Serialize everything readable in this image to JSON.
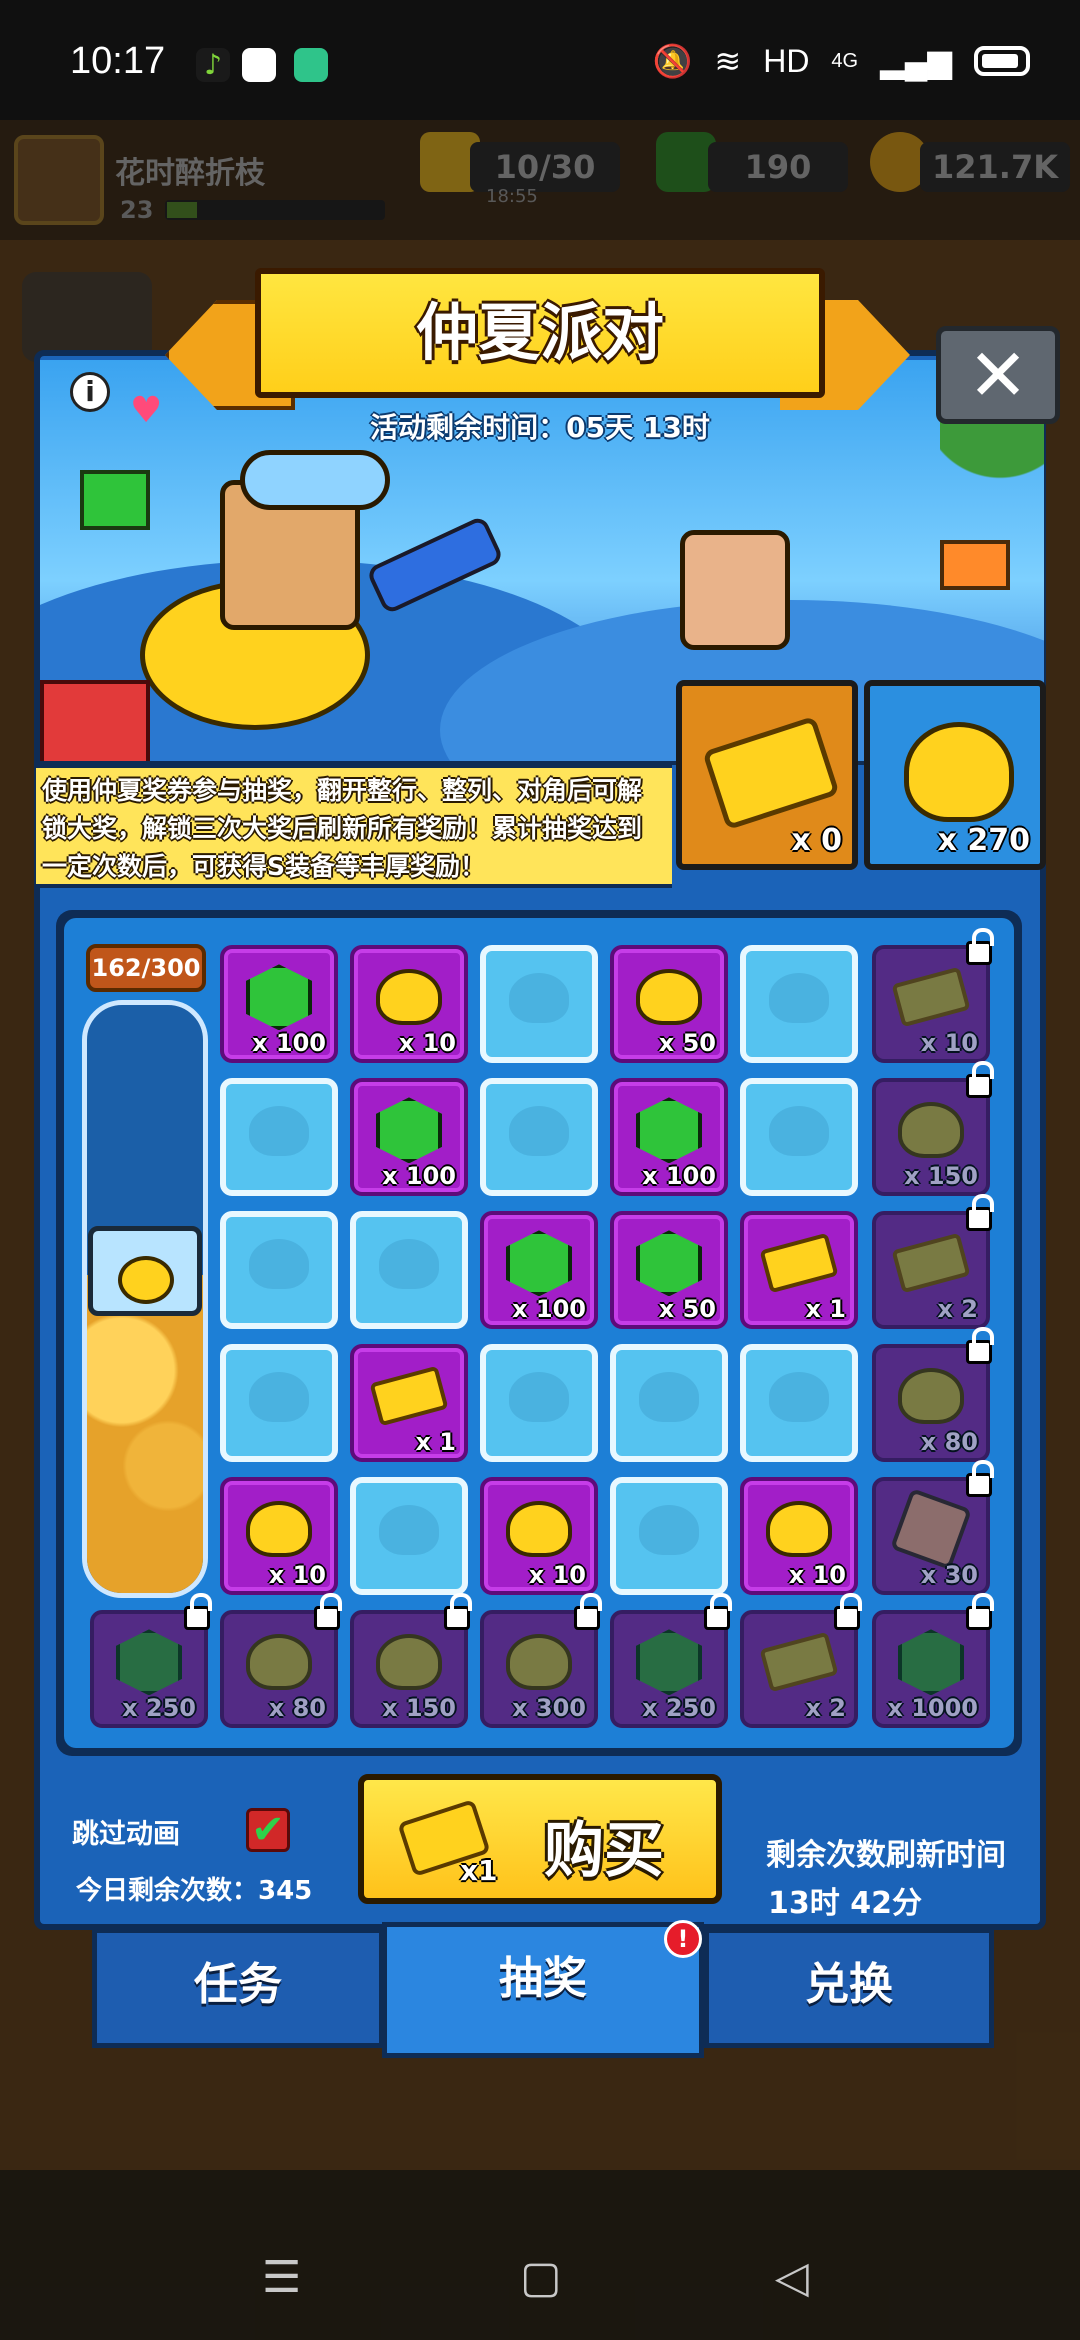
{
  "status_bar": {
    "time": "10:17",
    "network_label": "HD",
    "signal_label": "4G"
  },
  "player": {
    "name": "花时醉折枝",
    "level": "23"
  },
  "resources": {
    "stamina": "10/30",
    "stamina_timer": "18:55",
    "gems": "190",
    "coins": "121.7K"
  },
  "popup": {
    "title": "仲夏派对",
    "timer": "活动剩余时间：05天 13时",
    "close_icon": "close-icon",
    "description": "使用仲夏奖券参与抽奖，翻开整行、整列、对角后可解锁大奖，解锁三次大奖后刷新所有奖励！累计抽奖达到一定次数后，可获得S装备等丰厚奖励！",
    "ticket_count": "x 0",
    "duck_count": "x 270"
  },
  "progress": {
    "label": "162/300",
    "value": 162,
    "max": 300
  },
  "grid": {
    "rows": [
      [
        {
          "type": "gem",
          "qty": "x 100"
        },
        {
          "type": "duck",
          "qty": "x 10"
        },
        {
          "type": "empty",
          "qty": ""
        },
        {
          "type": "duck",
          "qty": "x 50"
        },
        {
          "type": "empty",
          "qty": ""
        },
        {
          "type": "ticket-locked",
          "qty": "x 10"
        }
      ],
      [
        {
          "type": "empty",
          "qty": ""
        },
        {
          "type": "gem",
          "qty": "x 100"
        },
        {
          "type": "empty",
          "qty": ""
        },
        {
          "type": "gem",
          "qty": "x 100"
        },
        {
          "type": "empty",
          "qty": ""
        },
        {
          "type": "duck-locked",
          "qty": "x 150"
        }
      ],
      [
        {
          "type": "empty",
          "qty": ""
        },
        {
          "type": "empty",
          "qty": ""
        },
        {
          "type": "gem",
          "qty": "x 100"
        },
        {
          "type": "gem",
          "qty": "x 50"
        },
        {
          "type": "ticket",
          "qty": "x 1"
        },
        {
          "type": "ticket-locked",
          "qty": "x 2"
        }
      ],
      [
        {
          "type": "empty",
          "qty": ""
        },
        {
          "type": "ticket",
          "qty": "x 1"
        },
        {
          "type": "empty",
          "qty": ""
        },
        {
          "type": "empty",
          "qty": ""
        },
        {
          "type": "empty",
          "qty": ""
        },
        {
          "type": "duck-locked",
          "qty": "x 80"
        }
      ],
      [
        {
          "type": "duck",
          "qty": "x 10"
        },
        {
          "type": "empty",
          "qty": ""
        },
        {
          "type": "duck",
          "qty": "x 10"
        },
        {
          "type": "empty",
          "qty": ""
        },
        {
          "type": "duck",
          "qty": "x 10"
        },
        {
          "type": "part-locked",
          "qty": "x 30"
        }
      ]
    ],
    "bottom_row": [
      {
        "type": "gem-locked",
        "qty": "x 250"
      },
      {
        "type": "duck-locked",
        "qty": "x 80"
      },
      {
        "type": "duck-locked",
        "qty": "x 150"
      },
      {
        "type": "duck-locked",
        "qty": "x 300"
      },
      {
        "type": "gem-locked",
        "qty": "x 250"
      },
      {
        "type": "ticket-locked",
        "qty": "x 2"
      },
      {
        "type": "gem-locked",
        "qty": "x 1000"
      }
    ]
  },
  "actions": {
    "skip_animation": "跳过动画",
    "skip_checked": true,
    "remaining_today": "今日剩余次数：345",
    "buy_label": "购买",
    "buy_cost": "x1",
    "refresh_label": "剩余次数刷新时间",
    "refresh_time": "13时 42分"
  },
  "tabs": [
    {
      "label": "任务",
      "active": false
    },
    {
      "label": "抽奖",
      "active": true,
      "badge": "!"
    },
    {
      "label": "兑换",
      "active": false
    }
  ],
  "colors": {
    "popup_blue": "#1b63b8",
    "item_purple": "#a21ec8",
    "empty_cyan": "#55c3f0",
    "title_yellow": "#ffd82a",
    "gem_green": "#2fc43a",
    "duck_yellow": "#ffd21e"
  }
}
